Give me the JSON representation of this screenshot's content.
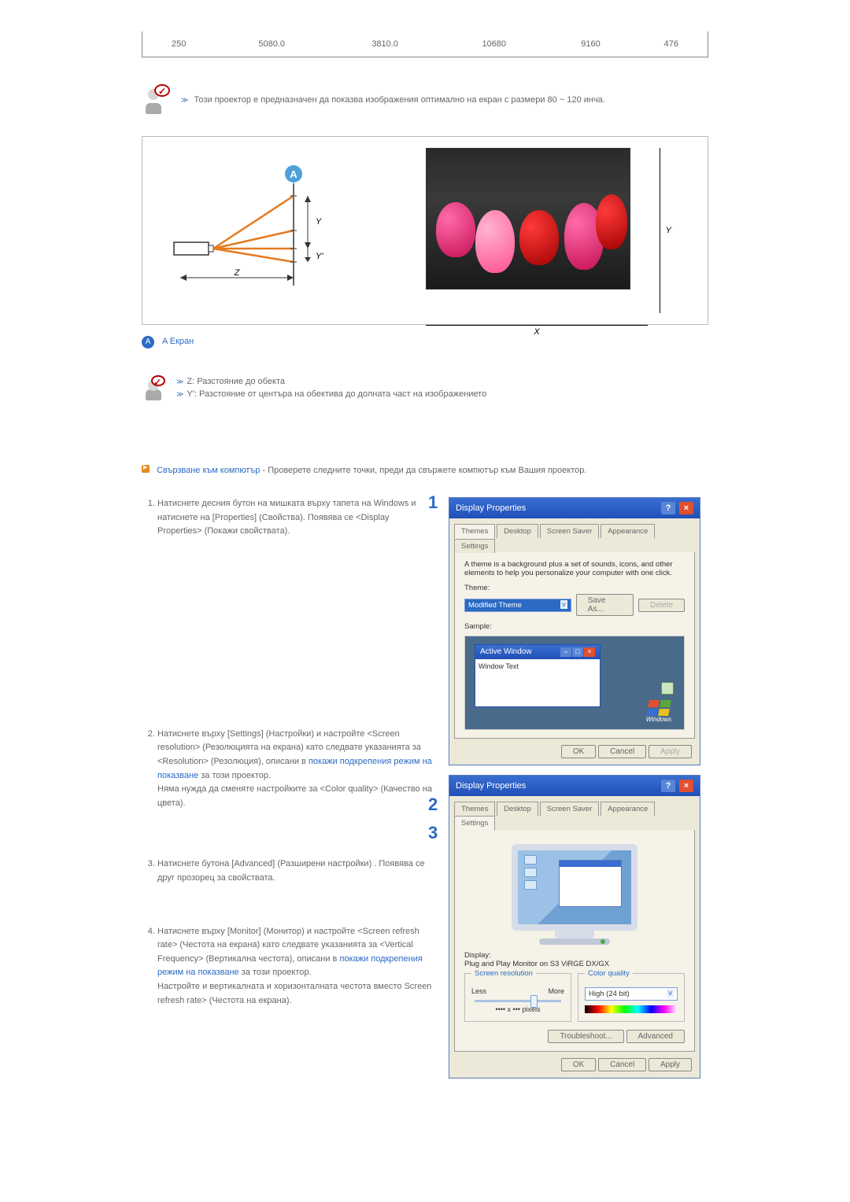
{
  "table": {
    "rows": [
      [
        "250",
        "5080.0",
        "3810.0",
        "10680",
        "9160",
        "476"
      ]
    ]
  },
  "tip1": "Този проектор е предназначен да показва изображения оптимално на екран с размери 80 ~ 120 инча.",
  "diagram": {
    "badge_letter": "A",
    "x_label": "X",
    "y_label": "Y",
    "z_label": "Z",
    "y2_label": "Y'",
    "caption_label": "A Екран"
  },
  "tip2": {
    "items": [
      "Z: Разстояние до обекта",
      "Y': Разстояние от центъра на обектива до долната част на изображението"
    ]
  },
  "section": {
    "title": "Свързване към компютър",
    "dash": " - ",
    "rest": "Проверете следните точки, преди да свържете компютър към Вашия проектор."
  },
  "steps": [
    {
      "text1": "Натиснете десния бутон на мишката върху тапета на Windows и натиснете на [Properties] (Свойства). Появява се <Display Properties> (Покажи свойствата)."
    },
    {
      "text1": "Натиснете върху [Settings] (Настройки) и настройте <Screen resolution> (Резолюцията на екрана) като следвате указанията за <Resolution> (Резолюция), описани в ",
      "link": "покажи подкрепения режим на показване",
      "text2": " за този проектор.",
      "text3": "Няма нужда да сменяте настройките за <Color quality> (Качество на цвета)."
    },
    {
      "text1": "Натиснете бутона [Advanced] (Разширени настройки) . Появява се друг прозорец за свойствата."
    },
    {
      "text1": "Натиснете върху [Monitor] (Монитор) и настройте <Screen refresh rate> (Честота на екрана) като следвате указанията за <Vertical Frequency> (Вертикална честота), описани в ",
      "link": "покажи подкрепения режим на показване",
      "text2": " за този проектор.",
      "text3": "Настройте и вертикалната и хоризонталната честота вместо Screen refresh rate> (Честота на екрана)."
    }
  ],
  "markers": [
    "1",
    "2",
    "3"
  ],
  "dialog1": {
    "title": "Display Properties",
    "tabs": [
      "Themes",
      "Desktop",
      "Screen Saver",
      "Appearance",
      "Settings"
    ],
    "active_tab": 0,
    "msg": "A theme is a background plus a set of sounds, icons, and other elements to help you personalize your computer with one click.",
    "theme_label": "Theme:",
    "theme_value": "Modified Theme",
    "save_as": "Save As...",
    "delete": "Delete",
    "sample_label": "Sample:",
    "active_window": "Active Window",
    "window_text": "Window Text",
    "windows_txt": "Windows",
    "ok": "OK",
    "cancel": "Cancel",
    "apply": "Apply"
  },
  "dialog2": {
    "title": "Display Properties",
    "tabs": [
      "Themes",
      "Desktop",
      "Screen Saver",
      "Appearance",
      "Settings"
    ],
    "active_tab": 4,
    "display_label": "Display:",
    "display_value": "Plug and Play Monitor on S3 ViRGE DX/GX",
    "res_legend": "Screen resolution",
    "less": "Less",
    "more": "More",
    "pixels": "•••• x ••• pixels",
    "cq_legend": "Color quality",
    "cq_value": "High (24 bit)",
    "troubleshoot": "Troubleshoot...",
    "advanced": "Advanced",
    "ok": "OK",
    "cancel": "Cancel",
    "apply": "Apply"
  }
}
